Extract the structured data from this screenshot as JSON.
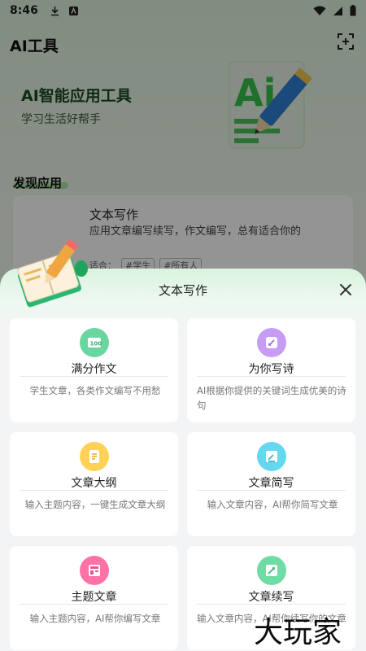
{
  "status_bar": {
    "time": "8:46"
  },
  "header": {
    "title": "AI工具"
  },
  "banner": {
    "title": "AI智能应用工具",
    "subtitle": "学习生活好帮手"
  },
  "section": {
    "title": "发现应用"
  },
  "background_card": {
    "title": "文本写作",
    "desc": "应用文章编写续写，作文编写，总有适合你的",
    "tags_label": "适合：",
    "tags": [
      "#学生",
      "#所有人"
    ]
  },
  "sheet": {
    "title": "文本写作",
    "tools": [
      {
        "name": "满分作文",
        "desc": "学生文章，各类作文编写不用愁",
        "icon": "essay-icon",
        "color": "#69d6a0"
      },
      {
        "name": "为你写诗",
        "desc": "AI根据你提供的关键词生成优美的诗句",
        "icon": "poem-icon",
        "color": "#c79cf5"
      },
      {
        "name": "文章大纲",
        "desc": "输入主题内容，一键生成文章大纲",
        "icon": "outline-icon",
        "color": "#ffd156"
      },
      {
        "name": "文章简写",
        "desc": "输入文章内容，AI帮你简写文章",
        "icon": "simplify-icon",
        "color": "#64d8ee"
      },
      {
        "name": "主题文章",
        "desc": "输入主题内容，AI帮你编写文章",
        "icon": "topic-icon",
        "color": "#ff72a8"
      },
      {
        "name": "文章续写",
        "desc": "输入文章内容，AI帮你续写你的文章",
        "icon": "continue-icon",
        "color": "#6fdca6"
      }
    ]
  },
  "watermark": {
    "text": "大玩家"
  }
}
